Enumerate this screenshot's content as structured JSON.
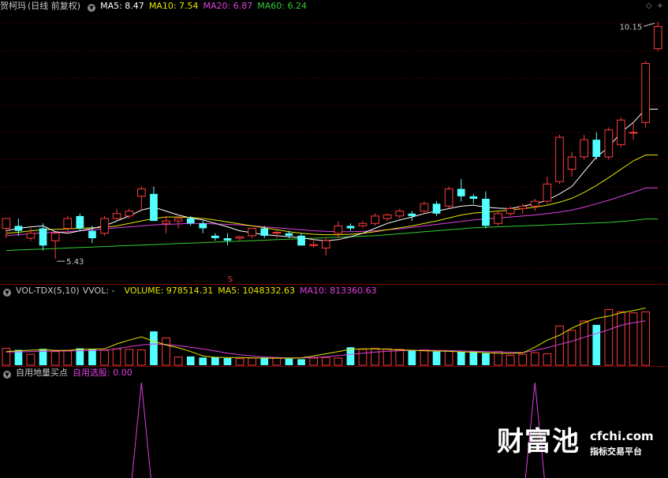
{
  "price_panel": {
    "stock_name": "贺柯玛",
    "period": "(日线 前复权)",
    "ma5_label": "MA5: 8.47",
    "ma10_label": "MA10: 7.54",
    "ma20_label": "MA20: 6.87",
    "ma60_label": "MA60: 6.24",
    "high_marker": "10.15",
    "low_marker": "5.43",
    "signal_marker": "S",
    "colors": {
      "ma5": "#ffffff",
      "ma10": "#e6e600",
      "ma20": "#e040e0",
      "ma60": "#33cc33",
      "up": "#ff3c3c",
      "down": "#54ffff"
    }
  },
  "volume_panel": {
    "indicator": "VOL-TDX(5,10)",
    "vvol": "VVOL: -",
    "volume_label": "VOLUME: 978514.31",
    "ma5_label": "MA5: 1048332.63",
    "ma10_label": "MA10: 813360.63"
  },
  "signal_panel": {
    "indicator": "自用地量买点",
    "value_label": "自用选股: 0.00"
  },
  "watermark": {
    "cn": "财富池",
    "domain": "cfchi.com",
    "tagline": "指标交易平台"
  },
  "chart_data": {
    "type": "candlestick",
    "price_range": [
      5.0,
      10.4
    ],
    "candles": [
      {
        "o": 6.05,
        "h": 6.25,
        "l": 5.85,
        "c": 6.25
      },
      {
        "o": 6.1,
        "h": 6.25,
        "l": 5.9,
        "c": 6.0
      },
      {
        "o": 5.85,
        "h": 6.05,
        "l": 5.8,
        "c": 5.95
      },
      {
        "o": 6.05,
        "h": 6.15,
        "l": 5.6,
        "c": 5.7
      },
      {
        "o": 5.8,
        "h": 5.95,
        "l": 5.43,
        "c": 5.95
      },
      {
        "o": 6.05,
        "h": 6.3,
        "l": 5.95,
        "c": 6.25
      },
      {
        "o": 6.3,
        "h": 6.35,
        "l": 6.0,
        "c": 6.05
      },
      {
        "o": 6.0,
        "h": 6.1,
        "l": 5.75,
        "c": 5.85
      },
      {
        "o": 5.95,
        "h": 6.3,
        "l": 5.9,
        "c": 6.25
      },
      {
        "o": 6.25,
        "h": 6.45,
        "l": 6.2,
        "c": 6.35
      },
      {
        "o": 6.3,
        "h": 6.45,
        "l": 6.25,
        "c": 6.4
      },
      {
        "o": 6.7,
        "h": 6.9,
        "l": 6.4,
        "c": 6.85
      },
      {
        "o": 6.75,
        "h": 6.9,
        "l": 6.2,
        "c": 6.2
      },
      {
        "o": 6.15,
        "h": 6.3,
        "l": 5.95,
        "c": 6.2
      },
      {
        "o": 6.2,
        "h": 6.3,
        "l": 6.05,
        "c": 6.25
      },
      {
        "o": 6.25,
        "h": 6.3,
        "l": 6.1,
        "c": 6.15
      },
      {
        "o": 6.15,
        "h": 6.2,
        "l": 5.95,
        "c": 6.05
      },
      {
        "o": 5.9,
        "h": 5.95,
        "l": 5.8,
        "c": 5.85
      },
      {
        "o": 5.85,
        "h": 5.95,
        "l": 5.7,
        "c": 5.8
      },
      {
        "o": 5.85,
        "h": 5.9,
        "l": 5.8,
        "c": 5.88
      },
      {
        "o": 5.9,
        "h": 6.05,
        "l": 5.85,
        "c": 6.05
      },
      {
        "o": 6.05,
        "h": 6.1,
        "l": 5.85,
        "c": 5.9
      },
      {
        "o": 5.95,
        "h": 6.0,
        "l": 5.85,
        "c": 5.97
      },
      {
        "o": 5.95,
        "h": 6.0,
        "l": 5.85,
        "c": 5.9
      },
      {
        "o": 5.9,
        "h": 5.95,
        "l": 5.75,
        "c": 5.7
      },
      {
        "o": 5.7,
        "h": 5.85,
        "l": 5.65,
        "c": 5.72
      },
      {
        "o": 5.65,
        "h": 5.85,
        "l": 5.5,
        "c": 5.8
      },
      {
        "o": 5.95,
        "h": 6.2,
        "l": 5.85,
        "c": 6.1
      },
      {
        "o": 6.1,
        "h": 6.15,
        "l": 6.0,
        "c": 6.05
      },
      {
        "o": 6.1,
        "h": 6.2,
        "l": 6.05,
        "c": 6.15
      },
      {
        "o": 6.15,
        "h": 6.35,
        "l": 6.1,
        "c": 6.3
      },
      {
        "o": 6.25,
        "h": 6.35,
        "l": 6.2,
        "c": 6.32
      },
      {
        "o": 6.3,
        "h": 6.45,
        "l": 6.25,
        "c": 6.4
      },
      {
        "o": 6.35,
        "h": 6.4,
        "l": 6.2,
        "c": 6.3
      },
      {
        "o": 6.4,
        "h": 6.6,
        "l": 6.35,
        "c": 6.55
      },
      {
        "o": 6.55,
        "h": 6.6,
        "l": 6.3,
        "c": 6.35
      },
      {
        "o": 6.5,
        "h": 6.9,
        "l": 6.45,
        "c": 6.85
      },
      {
        "o": 6.85,
        "h": 7.05,
        "l": 6.6,
        "c": 6.7
      },
      {
        "o": 6.7,
        "h": 6.75,
        "l": 6.55,
        "c": 6.65
      },
      {
        "o": 6.65,
        "h": 6.8,
        "l": 6.05,
        "c": 6.1
      },
      {
        "o": 6.15,
        "h": 6.4,
        "l": 6.1,
        "c": 6.35
      },
      {
        "o": 6.35,
        "h": 6.5,
        "l": 6.3,
        "c": 6.45
      },
      {
        "o": 6.45,
        "h": 6.55,
        "l": 6.35,
        "c": 6.5
      },
      {
        "o": 6.5,
        "h": 6.65,
        "l": 6.4,
        "c": 6.6
      },
      {
        "o": 6.6,
        "h": 7.1,
        "l": 6.55,
        "c": 6.95
      },
      {
        "o": 7.0,
        "h": 7.95,
        "l": 6.95,
        "c": 7.9
      },
      {
        "o": 7.25,
        "h": 7.6,
        "l": 7.1,
        "c": 7.5
      },
      {
        "o": 7.5,
        "h": 7.95,
        "l": 7.45,
        "c": 7.85
      },
      {
        "o": 7.85,
        "h": 8.0,
        "l": 7.45,
        "c": 7.5
      },
      {
        "o": 7.5,
        "h": 8.1,
        "l": 7.45,
        "c": 8.05
      },
      {
        "o": 7.75,
        "h": 8.3,
        "l": 7.7,
        "c": 8.25
      },
      {
        "o": 8.0,
        "h": 8.2,
        "l": 7.85,
        "c": 8.0
      },
      {
        "o": 8.2,
        "h": 9.45,
        "l": 8.1,
        "c": 9.4
      },
      {
        "o": 9.7,
        "h": 10.25,
        "l": 9.65,
        "c": 10.15
      }
    ],
    "ma5": [
      6.0,
      6.05,
      6.08,
      6.1,
      5.98,
      5.95,
      6.0,
      6.05,
      6.1,
      6.2,
      6.3,
      6.42,
      6.48,
      6.4,
      6.32,
      6.26,
      6.22,
      6.15,
      6.08,
      6.0,
      5.96,
      5.92,
      5.9,
      5.88,
      5.86,
      5.82,
      5.8,
      5.82,
      5.88,
      5.95,
      6.05,
      6.15,
      6.22,
      6.28,
      6.35,
      6.4,
      6.45,
      6.5,
      6.52,
      6.48,
      6.46,
      6.45,
      6.5,
      6.55,
      6.62,
      6.75,
      6.9,
      7.2,
      7.5,
      7.7,
      8.0,
      8.2,
      8.47,
      8.47
    ],
    "ma10": [
      5.95,
      5.97,
      6.0,
      6.02,
      6.03,
      6.04,
      6.05,
      6.06,
      6.07,
      6.1,
      6.15,
      6.2,
      6.25,
      6.28,
      6.28,
      6.27,
      6.25,
      6.22,
      6.18,
      6.14,
      6.1,
      6.06,
      6.02,
      5.98,
      5.95,
      5.93,
      5.92,
      5.92,
      5.93,
      5.95,
      5.98,
      6.02,
      6.06,
      6.1,
      6.15,
      6.2,
      6.26,
      6.32,
      6.36,
      6.38,
      6.4,
      6.42,
      6.45,
      6.48,
      6.52,
      6.58,
      6.66,
      6.78,
      6.92,
      7.08,
      7.25,
      7.42,
      7.54,
      7.54
    ],
    "ma20": [
      5.9,
      5.92,
      5.94,
      5.96,
      5.97,
      5.98,
      6.0,
      6.02,
      6.04,
      6.06,
      6.08,
      6.1,
      6.12,
      6.13,
      6.14,
      6.15,
      6.15,
      6.14,
      6.13,
      6.12,
      6.1,
      6.08,
      6.06,
      6.04,
      6.02,
      6.0,
      5.99,
      5.98,
      5.98,
      5.99,
      6.0,
      6.02,
      6.04,
      6.07,
      6.1,
      6.13,
      6.16,
      6.19,
      6.22,
      6.24,
      6.26,
      6.28,
      6.3,
      6.32,
      6.35,
      6.38,
      6.42,
      6.48,
      6.55,
      6.62,
      6.7,
      6.78,
      6.87,
      6.87
    ],
    "ma60": [
      5.6,
      5.61,
      5.62,
      5.63,
      5.64,
      5.65,
      5.66,
      5.67,
      5.68,
      5.69,
      5.7,
      5.71,
      5.72,
      5.73,
      5.74,
      5.75,
      5.76,
      5.77,
      5.78,
      5.79,
      5.8,
      5.81,
      5.82,
      5.83,
      5.84,
      5.85,
      5.86,
      5.87,
      5.88,
      5.89,
      5.9,
      5.92,
      5.94,
      5.96,
      5.98,
      6.0,
      6.02,
      6.04,
      6.06,
      6.07,
      6.08,
      6.09,
      6.1,
      6.11,
      6.12,
      6.13,
      6.14,
      6.15,
      6.16,
      6.17,
      6.19,
      6.21,
      6.24,
      6.24
    ],
    "volume_range": [
      0,
      1200000
    ],
    "volumes": [
      310000,
      280000,
      200000,
      300000,
      250000,
      270000,
      310000,
      300000,
      270000,
      300000,
      290000,
      280000,
      620000,
      500000,
      150000,
      160000,
      140000,
      150000,
      130000,
      120000,
      130000,
      140000,
      130000,
      120000,
      110000,
      130000,
      140000,
      130000,
      330000,
      290000,
      310000,
      300000,
      290000,
      270000,
      280000,
      250000,
      260000,
      240000,
      250000,
      220000,
      250000,
      180000,
      200000,
      230000,
      210000,
      720000,
      640000,
      810000,
      740000,
      1020000,
      980000,
      960000,
      978514
    ],
    "vol_ma5": [
      250000,
      265000,
      275000,
      285000,
      270000,
      270000,
      290000,
      295000,
      300000,
      390000,
      460000,
      520000,
      440000,
      370000,
      320000,
      250000,
      170000,
      145000,
      140000,
      140000,
      135000,
      130000,
      128000,
      130000,
      135000,
      170000,
      210000,
      250000,
      290000,
      300000,
      300000,
      290000,
      280000,
      275000,
      265000,
      260000,
      255000,
      245000,
      240000,
      230000,
      220000,
      215000,
      225000,
      330000,
      460000,
      550000,
      680000,
      780000,
      860000,
      900000,
      960000,
      1000000,
      1048332
    ],
    "vol_ma10": [
      240000,
      245000,
      250000,
      255000,
      260000,
      260000,
      265000,
      270000,
      275000,
      300000,
      340000,
      370000,
      390000,
      380000,
      360000,
      330000,
      300000,
      260000,
      220000,
      190000,
      170000,
      150000,
      140000,
      135000,
      133000,
      140000,
      155000,
      175000,
      200000,
      220000,
      240000,
      255000,
      265000,
      272000,
      275000,
      272000,
      268000,
      262000,
      256000,
      250000,
      244000,
      238000,
      232000,
      270000,
      320000,
      380000,
      440000,
      510000,
      580000,
      650000,
      730000,
      780000,
      813360
    ],
    "signal_spikes": [
      11,
      43
    ]
  }
}
